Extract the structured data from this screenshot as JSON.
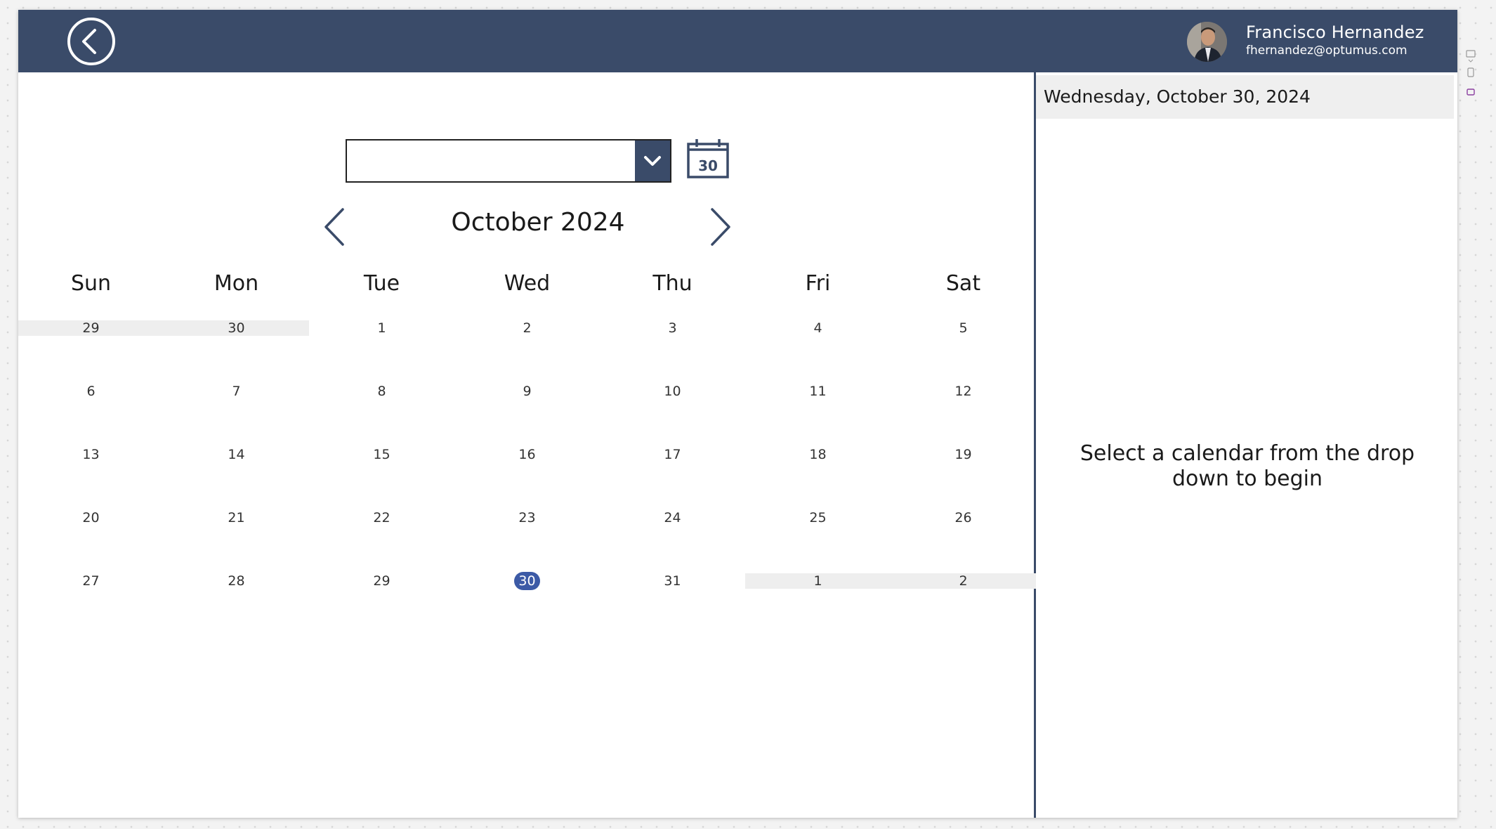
{
  "header": {
    "user_name": "Francisco Hernandez",
    "user_email": "fhernandez@optumus.com",
    "back_icon": "chevron-left-circle-icon",
    "bg_color": "#3a4b69"
  },
  "calendar_picker": {
    "selected_value": "",
    "dropdown_icon": "chevron-down-icon",
    "today_button_label": "30"
  },
  "calendar": {
    "month_title": "October 2024",
    "prev_icon": "chevron-left-icon",
    "next_icon": "chevron-right-icon",
    "days_of_week": [
      "Sun",
      "Mon",
      "Tue",
      "Wed",
      "Thu",
      "Fri",
      "Sat"
    ],
    "weeks": [
      [
        "29",
        "30",
        "1",
        "2",
        "3",
        "4",
        "5"
      ],
      [
        "6",
        "7",
        "8",
        "9",
        "10",
        "11",
        "12"
      ],
      [
        "13",
        "14",
        "15",
        "16",
        "17",
        "18",
        "19"
      ],
      [
        "20",
        "21",
        "22",
        "23",
        "24",
        "25",
        "26"
      ],
      [
        "27",
        "28",
        "29",
        "30",
        "31",
        "1",
        "2"
      ]
    ],
    "outside_month_days": [
      [
        0,
        0
      ],
      [
        0,
        1
      ],
      [
        4,
        5
      ],
      [
        4,
        6
      ]
    ],
    "selected_day": [
      4,
      3
    ],
    "selected_color": "#3c5aa6"
  },
  "detail_panel": {
    "selected_date": "Wednesday, October 30, 2024",
    "empty_message": "Select a calendar from the drop down to begin"
  }
}
